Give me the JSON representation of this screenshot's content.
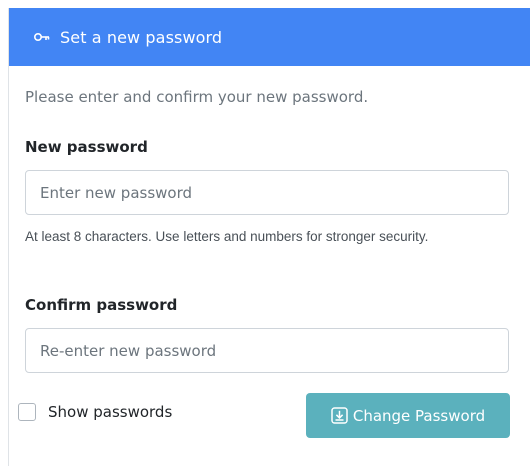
{
  "header": {
    "title": "Set a new password",
    "icon": "key-icon",
    "background": "#4285f4"
  },
  "intro": "Please enter and confirm your new password.",
  "new_password": {
    "label": "New password",
    "value": "",
    "placeholder": "Enter new password",
    "help": "At least 8 characters. Use letters and numbers for stronger security."
  },
  "confirm_password": {
    "label": "Confirm password",
    "value": "",
    "placeholder": "Re-enter new password"
  },
  "show_passwords": {
    "label": "Show passwords",
    "checked": false
  },
  "submit": {
    "label": "Change Password",
    "icon": "save-icon",
    "background": "#5bb1bd"
  }
}
